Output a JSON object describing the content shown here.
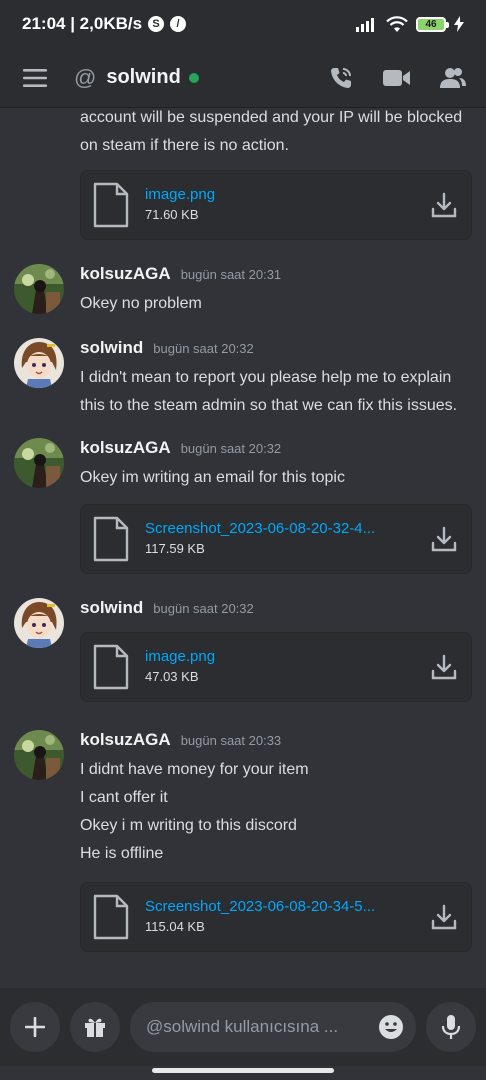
{
  "status_bar": {
    "time_speed": "21:04 | 2,0KB/s",
    "battery": "46",
    "colors": {
      "battery_fill": "#8bd36b"
    }
  },
  "header": {
    "channel_name": "solwind",
    "icons": [
      "menu-icon",
      "at-icon",
      "voice-call-icon",
      "video-call-icon",
      "members-icon"
    ],
    "colors": {
      "online": "#23a55a"
    }
  },
  "messages": [
    {
      "lines": [
        "account will be suspended and your IP will be blocked",
        "on steam if there is no action."
      ],
      "attachment": {
        "name": "image.png",
        "size": "71.60 KB"
      }
    },
    {
      "author": "kolsuzAGA",
      "time": "bugün saat 20:31",
      "lines": [
        "Okey no problem"
      ]
    },
    {
      "author": "solwind",
      "time": "bugün saat 20:32",
      "lines": [
        "I didn't mean to report you please help me to explain",
        "this to the steam admin so that we can fix this issues."
      ]
    },
    {
      "author": "kolsuzAGA",
      "time": "bugün saat 20:32",
      "lines": [
        "Okey im writing an email for this topic"
      ],
      "attachment": {
        "name": "Screenshot_2023-06-08-20-32-4...",
        "size": "117.59 KB"
      }
    },
    {
      "author": "solwind",
      "time": "bugün saat 20:32",
      "attachment": {
        "name": "image.png",
        "size": "47.03 KB"
      }
    },
    {
      "author": "kolsuzAGA",
      "time": "bugün saat 20:33",
      "lines": [
        "I didnt have money for your item",
        "I cant offer it",
        "Okey i m writing to this discord",
        "He is offline"
      ],
      "attachment": {
        "name": "Screenshot_2023-06-08-20-34-5...",
        "size": "115.04 KB"
      }
    }
  ],
  "composer": {
    "placeholder": "@solwind kullanıcısına ...",
    "icons": [
      "plus-icon",
      "gift-icon",
      "emoji-icon",
      "microphone-icon"
    ]
  },
  "colors": {
    "background": "#313338",
    "header": "#2b2d31",
    "link": "#00a8fc"
  }
}
